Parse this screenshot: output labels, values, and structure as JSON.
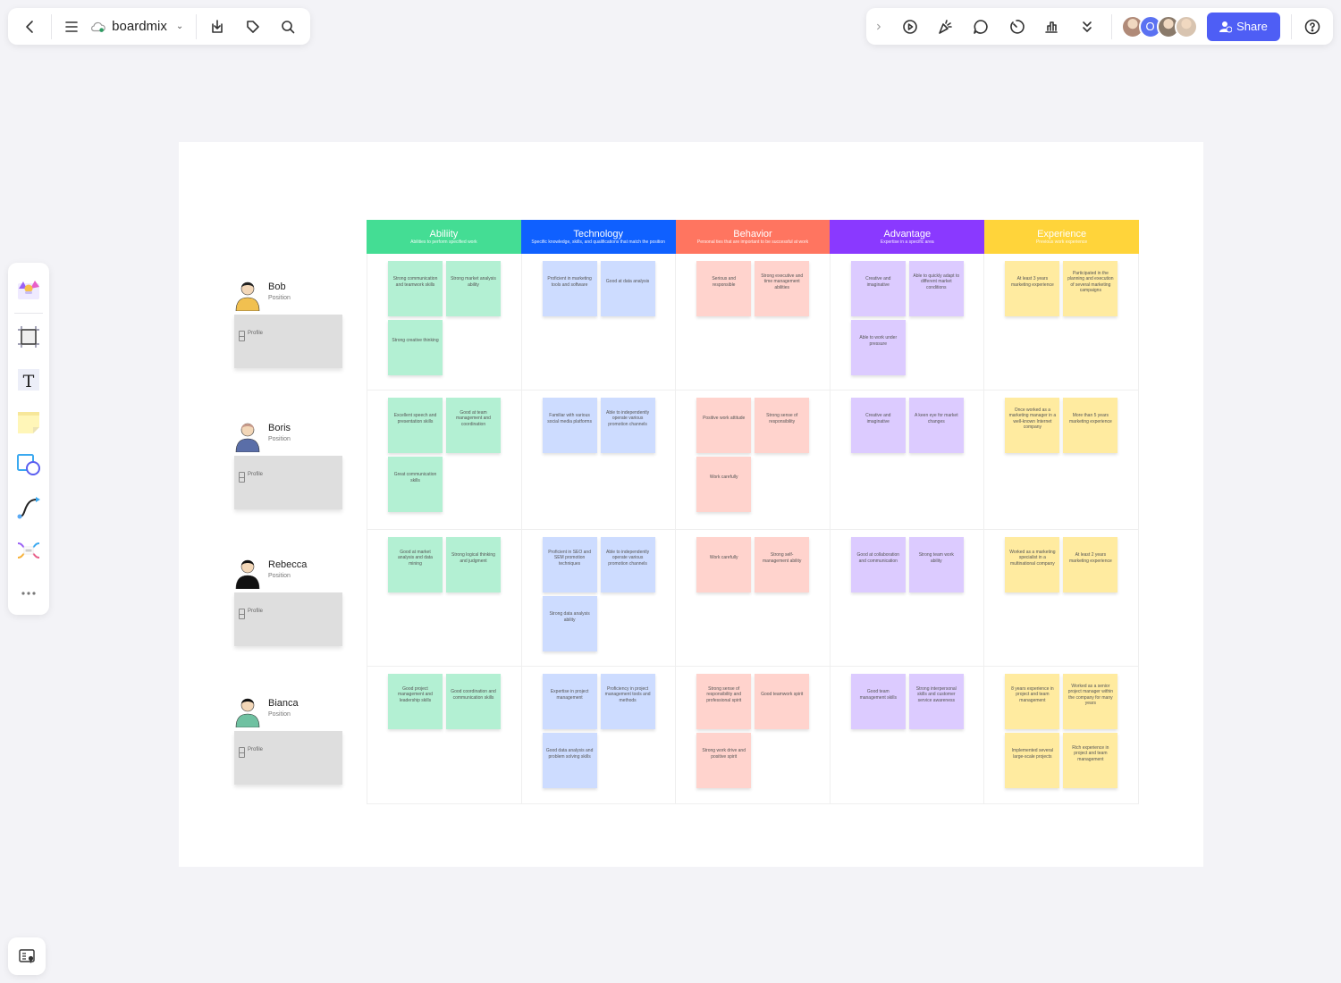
{
  "topbar": {
    "app_name": "boardmix",
    "left_icons": [
      "back-icon",
      "menu-icon",
      "cloud-sync-icon",
      "download-icon",
      "tag-icon",
      "search-icon"
    ],
    "right_icons": [
      "expand-icon",
      "present-icon",
      "celebrate-icon",
      "comment-icon",
      "timer-icon",
      "vote-icon",
      "more-icon"
    ],
    "share_label": "Share",
    "help_icon": "help-icon",
    "collaborators": [
      {
        "type": "photo",
        "color": "#b08a78"
      },
      {
        "type": "initial",
        "initial": "O",
        "color": "#5b72f2"
      },
      {
        "type": "photo",
        "color": "#8a7a6a"
      },
      {
        "type": "photo",
        "color": "#d8c4b0"
      }
    ]
  },
  "toolbar": {
    "tools": [
      "template-icon",
      "frame-icon",
      "text-icon",
      "sticky-note-icon",
      "shape-icon",
      "connector-icon",
      "mindmap-icon",
      "more-tools-icon"
    ]
  },
  "board": {
    "columns": [
      {
        "title": "Abiliity",
        "subtitle": "Abilities to perform specified work",
        "color": "#44dd94"
      },
      {
        "title": "Technology",
        "subtitle": "Specific knowledge, skills, and qualifications that match the position",
        "color": "#0f60ff"
      },
      {
        "title": "Behavior",
        "subtitle": "Personal ties that are important to be successful at work",
        "color": "#ff7560"
      },
      {
        "title": "Advantage",
        "subtitle": "Expertise in a specific area",
        "color": "#8a39ff"
      },
      {
        "title": "Experience",
        "subtitle": "Previous work experience",
        "color": "#ffd43a"
      }
    ],
    "note_colors": [
      "#b3f0d3",
      "#cddcff",
      "#ffd3cd",
      "#dccbff",
      "#ffeba0"
    ],
    "rows": [
      {
        "name": "Bob",
        "position": "Position",
        "profile_label": "Profile",
        "cells": [
          [
            "Strong communication and teamwork skills",
            "Strong market analysis ability",
            "Strong creative thinking"
          ],
          [
            "Proficient in marketing tools and software",
            "Good at data analysis"
          ],
          [
            "Serious and responsible",
            "Strong executive and time management abilities"
          ],
          [
            "Creative and imaginative",
            "Able to quickly adapt to different market conditions",
            "Able to work under pressure"
          ],
          [
            "At least 3 years marketing experience",
            "Participated in the planning and execution of several marketing campaigns"
          ]
        ]
      },
      {
        "name": "Boris",
        "position": "Position",
        "profile_label": "Profile",
        "cells": [
          [
            "Excellent speech and presentation skills",
            "Good at team management and coordination",
            "Great communication skills"
          ],
          [
            "Familiar with various social media platforms",
            "Able to independently operate various promotion channels"
          ],
          [
            "Positive work attitude",
            "Strong sense of responsibility",
            "Work carefully"
          ],
          [
            "Creative and imaginative",
            "A keen eye for market changes"
          ],
          [
            "Once worked as a marketing manager in a well-known Internet company",
            "More than 5 years marketing experience"
          ]
        ]
      },
      {
        "name": "Rebecca",
        "position": "Position",
        "profile_label": "Profile",
        "cells": [
          [
            "Good at market analysis and data mining",
            "Strong logical thinking and judgment"
          ],
          [
            "Proficient in SEO and SEM promotion techniques",
            "Able to independently operate various promotion channels",
            "Strong data analysis ability"
          ],
          [
            "Work carefully",
            "Strong self-management ability"
          ],
          [
            "Good at collaboration and communication",
            "Strong team work ability"
          ],
          [
            "Worked as a marketing specialist in a multinational company",
            "At least 2 years marketing experience"
          ]
        ]
      },
      {
        "name": "Bianca",
        "position": "Position",
        "profile_label": "Profile",
        "cells": [
          [
            "Good project management and leadership skills",
            "Good coordination and communication skills"
          ],
          [
            "Expertise in project management",
            "Proficiency in project management tools and methods",
            "Good data analysis and problem solving skills"
          ],
          [
            "Strong sense of responsibility and professional spirit",
            "Good teamwork spirit",
            "Strong work drive and positive spirit"
          ],
          [
            "Good team management skills",
            "Strong interpersonal skills and customer service awareness"
          ],
          [
            "8 years experience in project and team management",
            "Worked as a senior project manager within the company for many years",
            "Implemented several large-scale projects",
            "Rich experience in project and team management"
          ]
        ]
      }
    ]
  }
}
